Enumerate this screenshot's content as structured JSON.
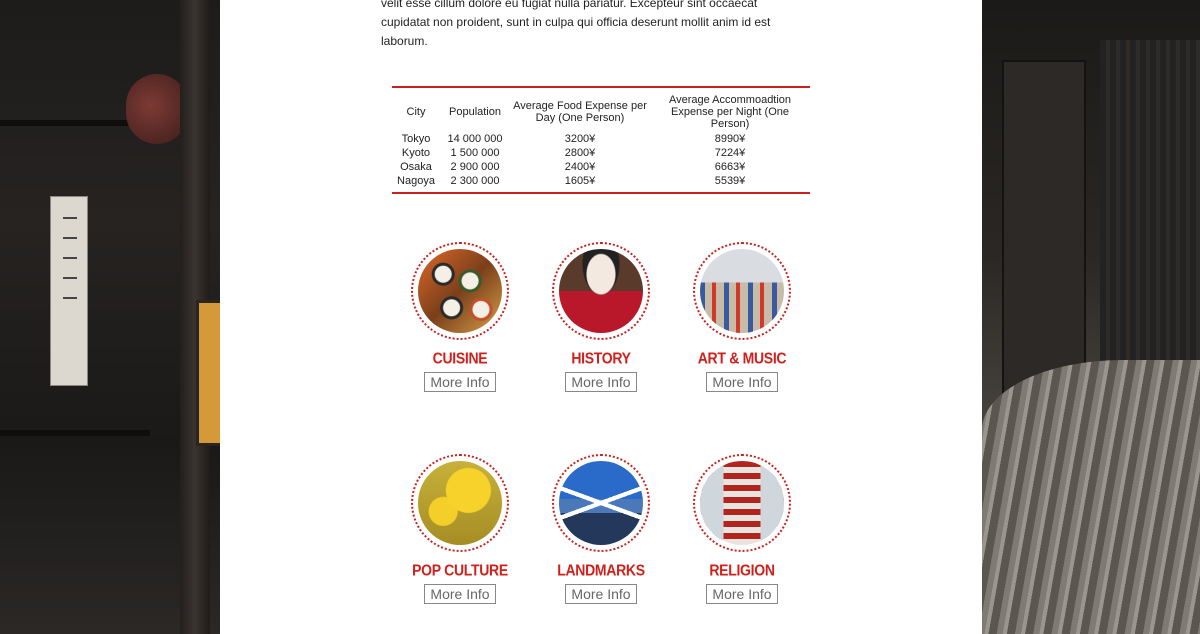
{
  "intro": {
    "lines": [
      "velit esse cillum dolore eu fugiat nulla pariatur. Excepteur sint occaecat",
      "cupidatat non proident, sunt in culpa qui officia deserunt mollit anim id est",
      "laborum."
    ]
  },
  "table": {
    "headers": [
      "City",
      "Population",
      "Average Food Expense per Day (One Person)",
      "Average Accommoadtion Expense per Night (One Person)"
    ],
    "rows": [
      [
        "Tokyo",
        "14 000 000",
        "3200¥",
        "8990¥"
      ],
      [
        "Kyoto",
        "1 500 000",
        "2800¥",
        "7224¥"
      ],
      [
        "Osaka",
        "2 900 000",
        "2400¥",
        "6663¥"
      ],
      [
        "Nagoya",
        "2 300 000",
        "1605¥",
        "5539¥"
      ]
    ]
  },
  "categories": [
    {
      "title": "CUISINE",
      "button": "More Info",
      "image": "sushi-photo"
    },
    {
      "title": "HISTORY",
      "button": "More Info",
      "image": "geisha-photo"
    },
    {
      "title": "ART & MUSIC",
      "button": "More Info",
      "image": "carp-streamers-photo"
    },
    {
      "title": "POP CULTURE",
      "button": "More Info",
      "image": "pikachu-photo"
    },
    {
      "title": "LANDMARKS",
      "button": "More Info",
      "image": "mount-fuji-photo"
    },
    {
      "title": "RELIGION",
      "button": "More Info",
      "image": "pagoda-photo"
    }
  ],
  "colors": {
    "accent": "#c8231e",
    "text": "#222222",
    "button_text": "#666666"
  }
}
